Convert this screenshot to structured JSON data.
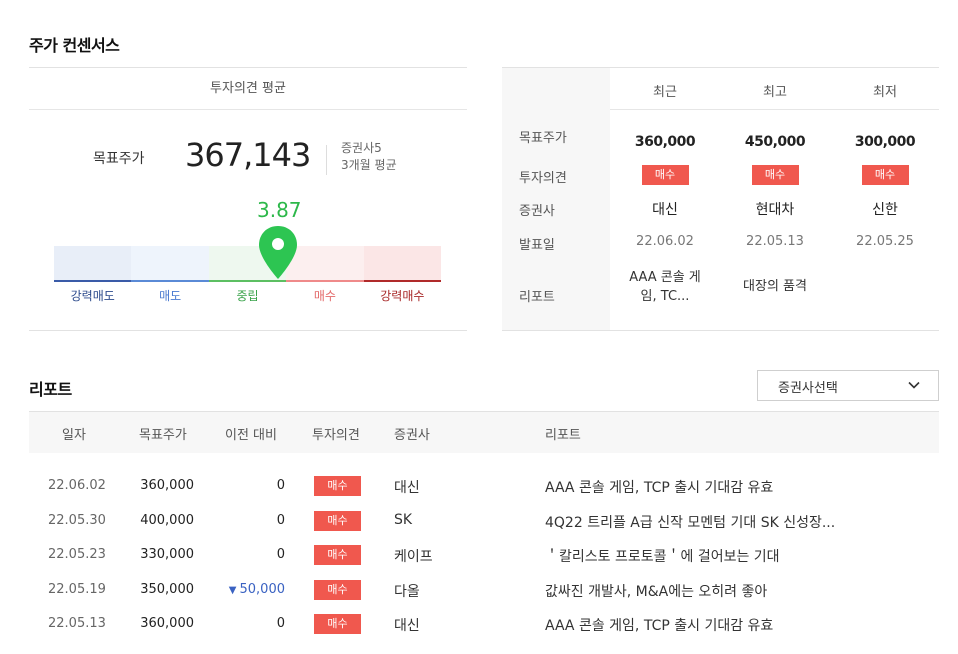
{
  "consensus": {
    "title": "주가 컨센서스",
    "opinion_avg_header": "투자의견 평균",
    "target_label": "목표주가",
    "target_value": "367,143",
    "broker_count": "증권사5",
    "period": "3개월 평균",
    "score": "3.87",
    "score_fraction": 0.5,
    "gauge_labels": [
      "강력매도",
      "매도",
      "중립",
      "매수",
      "강력매수"
    ],
    "colors": {
      "score": "#2db84a",
      "badge": "#f0584e"
    }
  },
  "summary": {
    "columns": [
      "최근",
      "최고",
      "최저"
    ],
    "row_labels": [
      "목표주가",
      "투자의견",
      "증권사",
      "발표일",
      "리포트"
    ],
    "recent": {
      "price": "360,000",
      "opinion": "매수",
      "broker": "대신",
      "date": "22.06.02",
      "report_l1": "AAA 콘솔 게",
      "report_l2": "임, TC..."
    },
    "high": {
      "price": "450,000",
      "opinion": "매수",
      "broker": "현대차",
      "date": "22.05.13",
      "report_l1": "대장의 품격"
    },
    "low": {
      "price": "300,000",
      "opinion": "매수",
      "broker": "신한",
      "date": "22.05.25"
    }
  },
  "reports": {
    "title": "리포트",
    "select_label": "증권사선택",
    "headers": [
      "일자",
      "목표주가",
      "이전 대비",
      "투자의견",
      "증권사",
      "리포트"
    ],
    "rows": [
      {
        "date": "22.06.02",
        "price": "360,000",
        "change": "0",
        "opinion": "매수",
        "broker": "대신",
        "report": "AAA 콘솔 게임, TCP 출시 기대감 유효"
      },
      {
        "date": "22.05.30",
        "price": "400,000",
        "change": "0",
        "opinion": "매수",
        "broker": "SK",
        "report": "4Q22 트리플 A급 신작 모멘텀 기대 SK 신성장..."
      },
      {
        "date": "22.05.23",
        "price": "330,000",
        "change": "0",
        "opinion": "매수",
        "broker": "케이프",
        "report": "＇칼리스토 프로토콜＇에 걸어보는 기대"
      },
      {
        "date": "22.05.19",
        "price": "350,000",
        "change": "50,000",
        "change_dir": "down",
        "opinion": "매수",
        "broker": "다올",
        "report": "값싸진 개발사, M&A에는 오히려 좋아"
      },
      {
        "date": "22.05.13",
        "price": "360,000",
        "change": "0",
        "opinion": "매수",
        "broker": "대신",
        "report": "AAA 콘솔 게임, TCP 출시 기대감 유효"
      }
    ]
  }
}
